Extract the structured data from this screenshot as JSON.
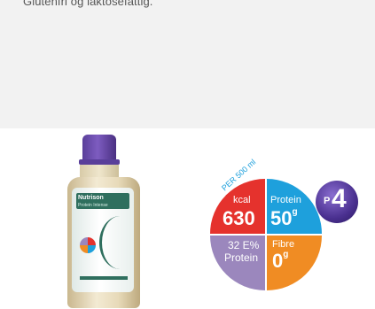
{
  "description": "Glutenfri og laktosefattig.",
  "product": {
    "label_brand": "Nutrison",
    "label_name": "Protein Intense"
  },
  "wheel": {
    "per_label": "PER 500 ml",
    "kcal": {
      "label": "kcal",
      "value": "630",
      "color": "#e5322d"
    },
    "protein": {
      "label": "Protein",
      "value": "50",
      "unit": "g",
      "color": "#1ea0dc"
    },
    "energy": {
      "line1": "32 E%",
      "line2": "Protein",
      "color": "#9b87bd"
    },
    "fibre": {
      "label": "Fibre",
      "value": "0",
      "unit": "g",
      "color": "#f08c23"
    }
  },
  "badge": {
    "prefix": "P",
    "number": "4"
  }
}
